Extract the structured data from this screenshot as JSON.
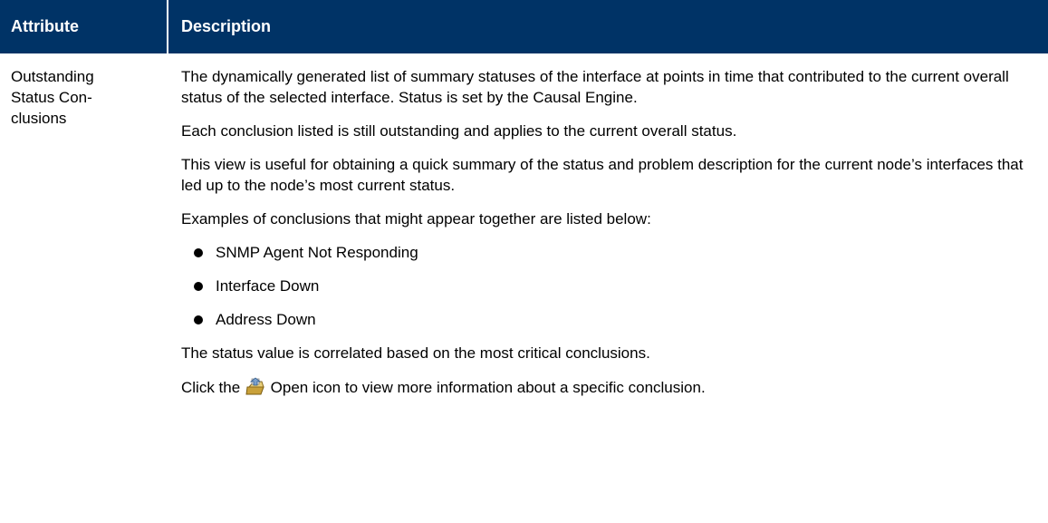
{
  "header": {
    "attribute": "Attribute",
    "description": "Description"
  },
  "row": {
    "attribute_lines": [
      "Outstanding",
      "Status Con-",
      "clusions"
    ],
    "paragraphs": [
      "The dynamically generated list of summary statuses of the interface at points in time that contributed to the current overall status of the selected interface. Status is set by the Causal Engine.",
      "Each conclusion listed is still outstanding and applies to the current overall status.",
      "This view is useful for obtaining a quick summary of the status and problem description for the current node’s interfaces that led up to the node’s most current status.",
      "Examples of conclusions that might appear together are listed below:"
    ],
    "bullets": [
      "SNMP Agent Not Responding",
      "Interface Down",
      "Address Down"
    ],
    "closing_paragraph": "The status value is correlated based on the most critical conclusions.",
    "last_line": {
      "before_icon": "Click the ",
      "icon": "open-icon",
      "after_icon": " Open icon to view more information about a specific conclusion."
    }
  },
  "colors": {
    "header_background": "#003366",
    "header_text": "#ffffff"
  }
}
